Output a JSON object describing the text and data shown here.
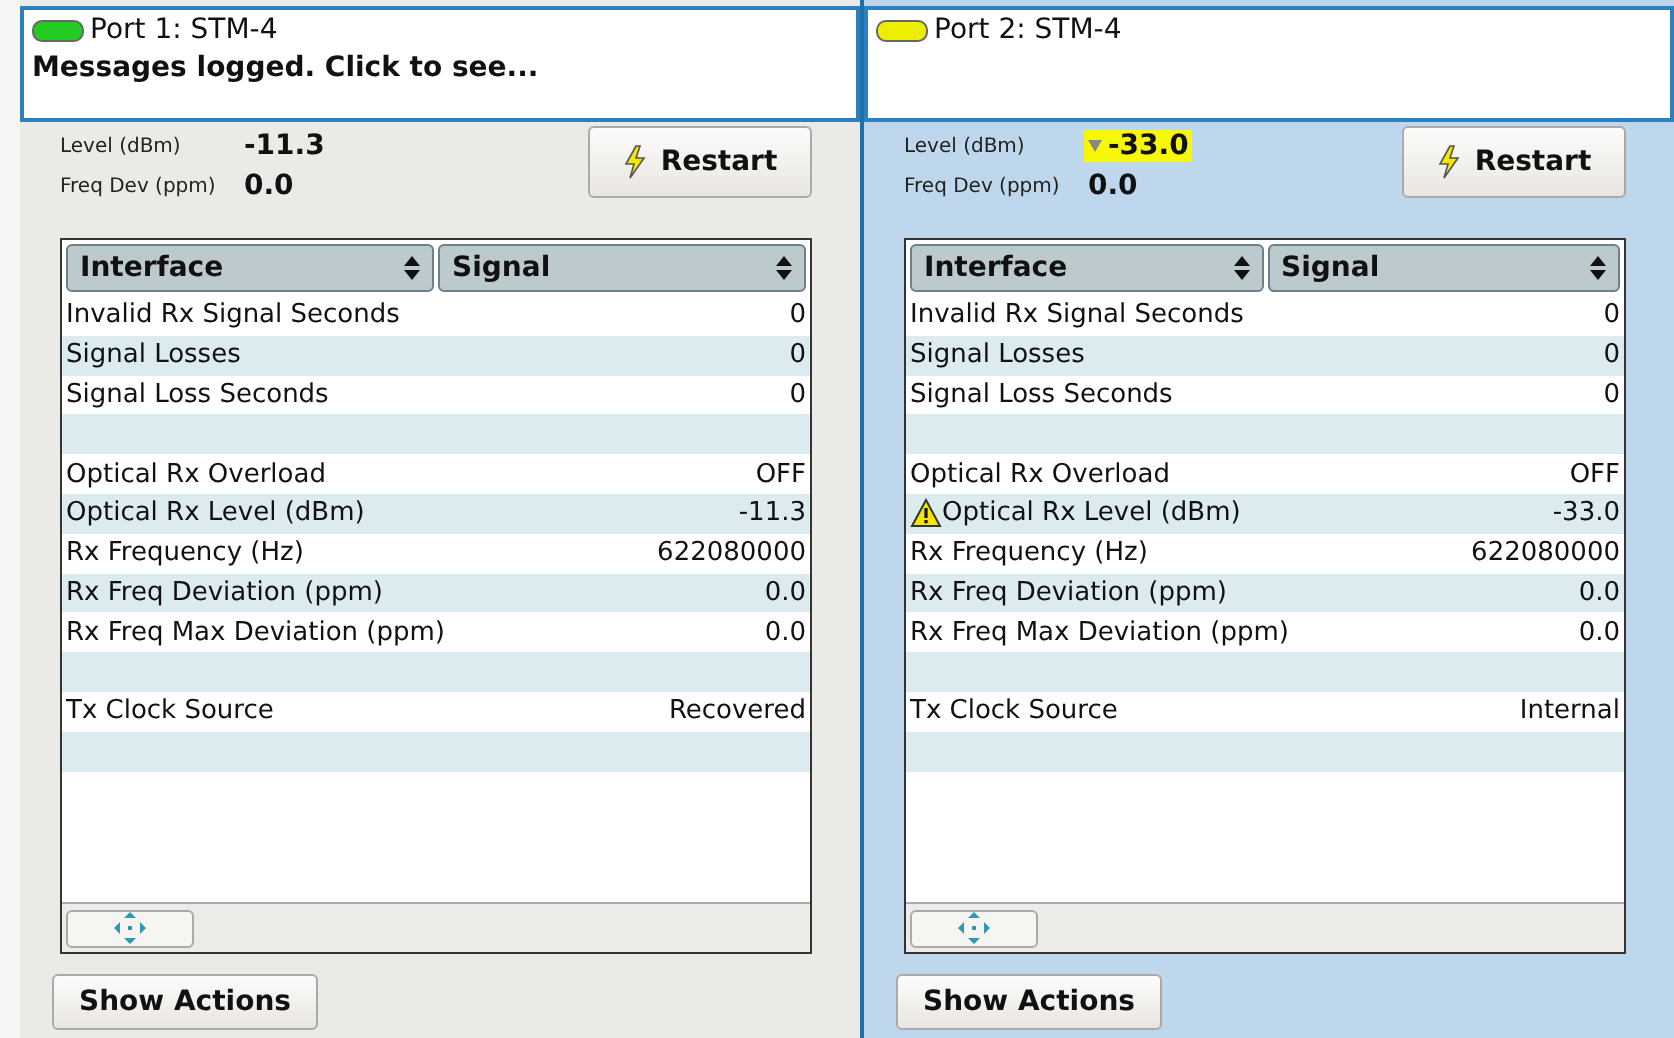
{
  "ports": [
    {
      "selected": false,
      "color": "#22cc22",
      "title": "Port 1: STM-4",
      "message": "Messages logged. Click to see...",
      "level_label": "Level (dBm)",
      "level_value": "-11.3",
      "level_alarm": false,
      "freq_label": "Freq Dev (ppm)",
      "freq_value": "0.0",
      "restart": "Restart",
      "columns": [
        "Interface",
        "Signal"
      ],
      "rows": [
        {
          "kind": "stat",
          "label": "Invalid Rx Signal Seconds",
          "value": "0",
          "warning": false
        },
        {
          "kind": "stat",
          "label": "Signal Losses",
          "value": "0",
          "warning": false
        },
        {
          "kind": "stat",
          "label": "Signal Loss Seconds",
          "value": "0",
          "warning": false
        },
        {
          "kind": "blank"
        },
        {
          "kind": "stat",
          "label": "Optical Rx Overload",
          "value": "OFF",
          "warning": false
        },
        {
          "kind": "stat",
          "label": "Optical Rx Level (dBm)",
          "value": "-11.3",
          "warning": false
        },
        {
          "kind": "stat",
          "label": "Rx Frequency (Hz)",
          "value": "622080000",
          "warning": false
        },
        {
          "kind": "stat",
          "label": "Rx Freq Deviation (ppm)",
          "value": "0.0",
          "warning": false
        },
        {
          "kind": "stat",
          "label": "Rx Freq Max Deviation (ppm)",
          "value": "0.0",
          "warning": false
        },
        {
          "kind": "blank"
        },
        {
          "kind": "stat",
          "label": "Tx Clock Source",
          "value": "Recovered",
          "warning": false
        },
        {
          "kind": "blank"
        }
      ],
      "actions": "Show Actions"
    },
    {
      "selected": true,
      "color": "#eeee00",
      "title": "Port 2: STM-4",
      "level_label": "Level (dBm)",
      "level_value": "-33.0",
      "level_alarm": true,
      "freq_label": "Freq Dev (ppm)",
      "freq_value": "0.0",
      "restart": "Restart",
      "columns": [
        "Interface",
        "Signal"
      ],
      "rows": [
        {
          "kind": "stat",
          "label": "Invalid Rx Signal Seconds",
          "value": "0",
          "warning": false
        },
        {
          "kind": "stat",
          "label": "Signal Losses",
          "value": "0",
          "warning": false
        },
        {
          "kind": "stat",
          "label": "Signal Loss Seconds",
          "value": "0",
          "warning": false
        },
        {
          "kind": "blank"
        },
        {
          "kind": "stat",
          "label": "Optical Rx Overload",
          "value": "OFF",
          "warning": false
        },
        {
          "kind": "stat",
          "label": "Optical Rx Level (dBm)",
          "value": "-33.0",
          "warning": true
        },
        {
          "kind": "stat",
          "label": "Rx Frequency (Hz)",
          "value": "622080000",
          "warning": false
        },
        {
          "kind": "stat",
          "label": "Rx Freq Deviation (ppm)",
          "value": "0.0",
          "warning": false
        },
        {
          "kind": "stat",
          "label": "Rx Freq Max Deviation (ppm)",
          "value": "0.0",
          "warning": false
        },
        {
          "kind": "blank"
        },
        {
          "kind": "stat",
          "label": "Tx Clock Source",
          "value": "Internal",
          "warning": false
        },
        {
          "kind": "blank"
        }
      ],
      "actions": "Show Actions"
    }
  ]
}
